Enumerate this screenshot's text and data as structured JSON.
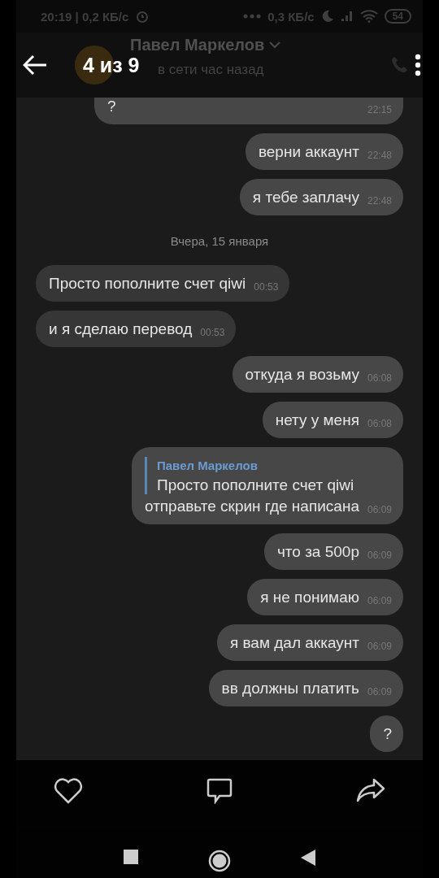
{
  "viewer": {
    "counter": "4 из 9"
  },
  "status_bar": {
    "left": "20:19 | 0,2 КБ/с",
    "speed": "0,3 КБ/с",
    "battery": "54"
  },
  "chat_header": {
    "name": "Павел Маркелов",
    "status": "в сети час назад"
  },
  "messages": [
    {
      "kind": "out",
      "text": "?",
      "time": "22:15"
    },
    {
      "kind": "out",
      "text": "верни аккаунт",
      "time": "22:48"
    },
    {
      "kind": "out",
      "text": "я тебе заплачу",
      "time": "22:48"
    },
    {
      "kind": "date",
      "text": "Вчера, 15 января"
    },
    {
      "kind": "in",
      "text": "Просто пополните счет qiwi",
      "time": "00:53"
    },
    {
      "kind": "in",
      "text": "и я сделаю перевод",
      "time": "00:53"
    },
    {
      "kind": "out",
      "text": "откуда я возьму",
      "time": "06:08"
    },
    {
      "kind": "out",
      "text": "нету у меня",
      "time": "06:08"
    },
    {
      "kind": "out",
      "text": "отправьте скрин где написана",
      "time": "06:09",
      "quote": {
        "author": "Павел Маркелов",
        "text": "Просто пополните счет qiwi"
      }
    },
    {
      "kind": "out",
      "text": "что за 500р",
      "time": "06:09"
    },
    {
      "kind": "out",
      "text": "я не понимаю",
      "time": "06:09"
    },
    {
      "kind": "out",
      "text": "я вам дал аккаунт",
      "time": "06:09"
    },
    {
      "kind": "out",
      "text": "вв должны платить",
      "time": "06:09"
    },
    {
      "kind": "out",
      "text": "?"
    }
  ]
}
